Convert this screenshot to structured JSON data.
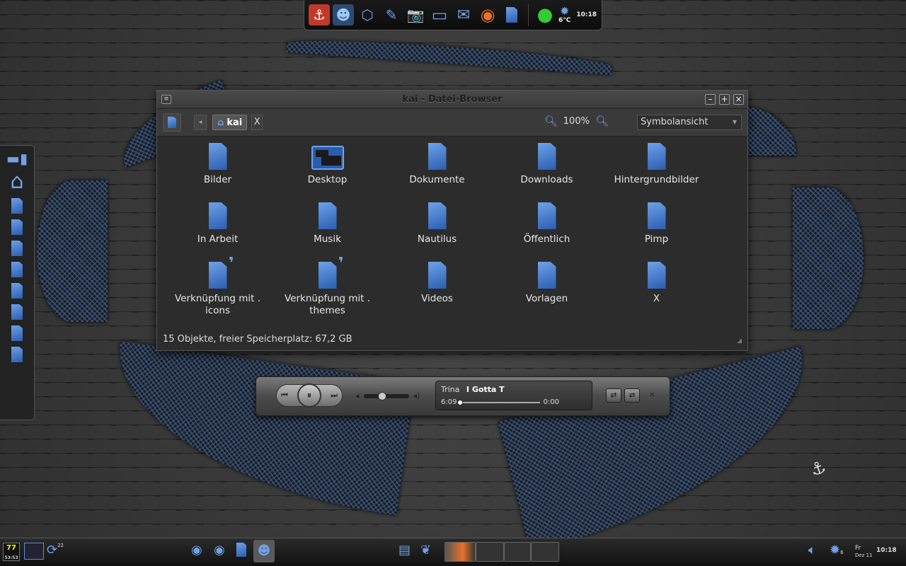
{
  "desktop": {
    "background_color": "#3b3b3b",
    "accent": "#5b8fd6"
  },
  "top_dock": {
    "items": [
      {
        "name": "anchor-icon",
        "glyph": "⚓"
      },
      {
        "name": "mascot-icon",
        "glyph": "☻"
      },
      {
        "name": "cube-icon",
        "glyph": "⬡"
      },
      {
        "name": "gimp-icon",
        "glyph": "✎"
      },
      {
        "name": "camera-icon",
        "glyph": "📷"
      },
      {
        "name": "screen-icon",
        "glyph": "▭"
      },
      {
        "name": "mail-icon",
        "glyph": "✉"
      },
      {
        "name": "firefox-icon",
        "glyph": "◉"
      },
      {
        "name": "document-icon",
        "glyph": ""
      },
      {
        "name": "status-orb-icon",
        "glyph": "●"
      }
    ],
    "weather_temp": "6°C",
    "clock": "10:18"
  },
  "window": {
    "title": "kai - Datei-Browser",
    "breadcrumb": "kai",
    "breadcrumb_close": "X",
    "zoom": "100%",
    "view_mode": "Symbolansicht",
    "items": [
      {
        "label": "Bilder",
        "type": "folder"
      },
      {
        "label": "Desktop",
        "type": "desktop"
      },
      {
        "label": "Dokumente",
        "type": "folder"
      },
      {
        "label": "Downloads",
        "type": "folder"
      },
      {
        "label": "Hintergrundbilder",
        "type": "folder"
      },
      {
        "label": "In Arbeit",
        "type": "folder"
      },
      {
        "label": "Musik",
        "type": "folder"
      },
      {
        "label": "Nautilus",
        "type": "folder"
      },
      {
        "label": "Öffentlich",
        "type": "folder"
      },
      {
        "label": "Pimp",
        "type": "folder"
      },
      {
        "label": "Verknüpfung mit . icons",
        "type": "link"
      },
      {
        "label": "Verknüpfung mit . themes",
        "type": "link"
      },
      {
        "label": "Videos",
        "type": "folder"
      },
      {
        "label": "Vorlagen",
        "type": "folder"
      },
      {
        "label": "X",
        "type": "folder"
      }
    ],
    "status": "15 Objekte, freier Speicherplatz: 67,2 GB"
  },
  "player": {
    "artist": "Trina",
    "song": "I Gotta T",
    "elapsed": "6:09",
    "remaining": "0:00",
    "close": "×"
  },
  "bottom_panel": {
    "cpu_top": "77",
    "cpu_bottom": "53:53",
    "updates": "22",
    "clock": "10:18",
    "day": "Fr",
    "date": "Dez 11",
    "weather": "6"
  }
}
